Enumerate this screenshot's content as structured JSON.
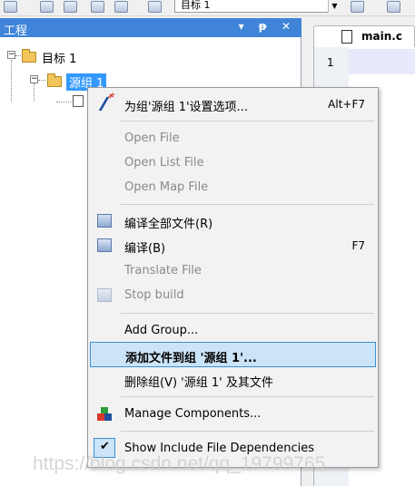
{
  "toolbar": {
    "target_value": "目标 1",
    "dropdown_glyph": "▼"
  },
  "project_panel": {
    "title": "工程",
    "buttons": "▾ ᵽ ✕"
  },
  "tree": {
    "root_expander": "−",
    "root_label": "目标 1",
    "group_expander": "−",
    "group_label": "源组 1"
  },
  "editor": {
    "tab_label": "main.c",
    "line_number": "1"
  },
  "context_menu": {
    "items": [
      {
        "label": "为组'源组 1'设置选项...",
        "shortcut": "Alt+F7",
        "enabled": true,
        "icon": "magic-wand-icon"
      },
      {
        "label": "Open File",
        "shortcut": "",
        "enabled": false
      },
      {
        "label": "Open List File",
        "shortcut": "",
        "enabled": false
      },
      {
        "label": "Open Map File",
        "shortcut": "",
        "enabled": false
      },
      {
        "label": "编译全部文件(R)",
        "shortcut": "",
        "enabled": true,
        "icon": "rebuild-icon"
      },
      {
        "label": "编译(B)",
        "shortcut": "F7",
        "enabled": true,
        "icon": "build-icon"
      },
      {
        "label": "Translate File",
        "shortcut": "",
        "enabled": false
      },
      {
        "label": "Stop build",
        "shortcut": "",
        "enabled": false,
        "icon": "stop-build-icon"
      },
      {
        "label": "Add Group...",
        "shortcut": "",
        "enabled": true
      },
      {
        "label": "添加文件到组 '源组 1'...",
        "shortcut": "",
        "enabled": true,
        "highlighted": true
      },
      {
        "label": "删除组(V) '源组 1' 及其文件",
        "shortcut": "",
        "enabled": true
      },
      {
        "label": "Manage Components...",
        "shortcut": "",
        "enabled": true,
        "icon": "components-icon"
      },
      {
        "label": "Show Include File Dependencies",
        "shortcut": "",
        "enabled": true,
        "checked": true
      }
    ],
    "check_glyph": "✔"
  },
  "watermark": "https://blog.csdn.net/qq_19799765",
  "colors": {
    "panel_header": "#3f84d8",
    "selection": "#3399ff",
    "menu_highlight": "#cce4f7",
    "menu_highlight_border": "#3a8fd6"
  }
}
